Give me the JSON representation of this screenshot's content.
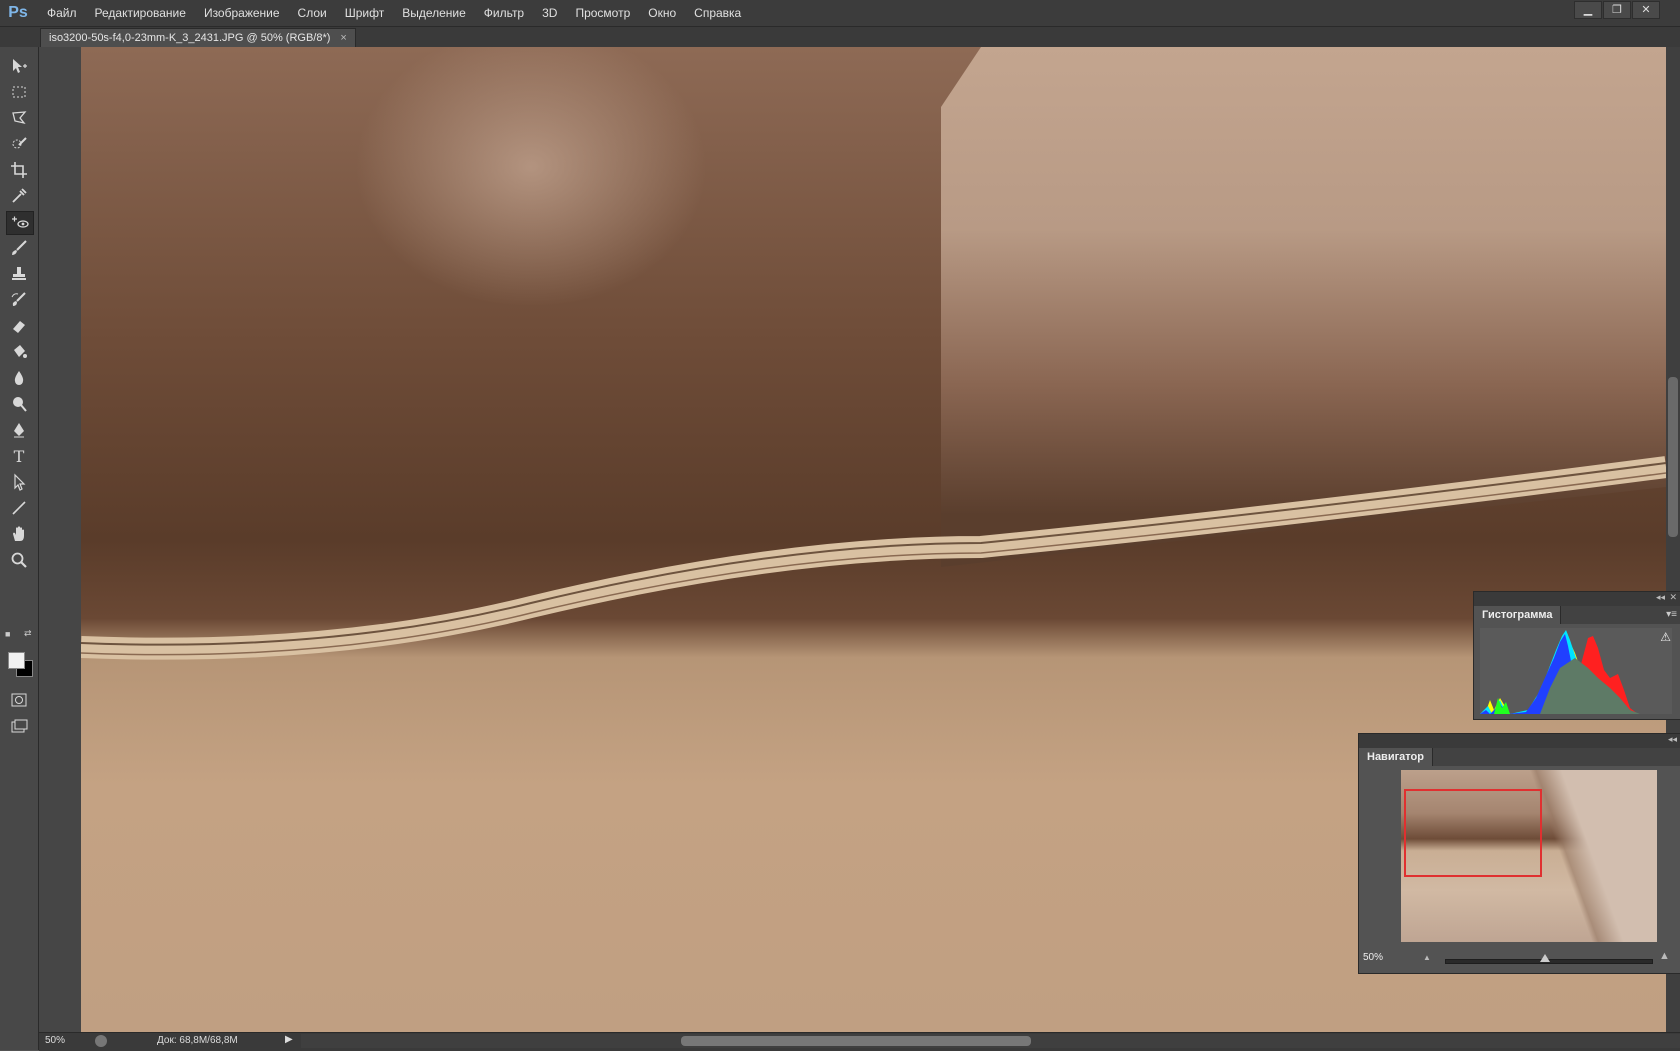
{
  "app": {
    "logo": "Ps"
  },
  "menu": {
    "items": [
      "Файл",
      "Редактирование",
      "Изображение",
      "Слои",
      "Шрифт",
      "Выделение",
      "Фильтр",
      "3D",
      "Просмотр",
      "Окно",
      "Справка"
    ]
  },
  "window_controls": {
    "minimize": "▁",
    "restore": "❐",
    "close": "✕"
  },
  "document": {
    "tab_title": "iso3200-50s-f4,0-23mm-K_3_2431.JPG @ 50% (RGB/8*)",
    "close_icon": "×"
  },
  "toolbar": {
    "collapse": "▸▸",
    "tools": [
      {
        "name": "move-tool",
        "icon": "move-icon"
      },
      {
        "name": "marquee-tool",
        "icon": "marquee-icon"
      },
      {
        "name": "lasso-tool",
        "icon": "lasso-icon"
      },
      {
        "name": "quick-selection-tool",
        "icon": "quick-selection-icon"
      },
      {
        "name": "crop-tool",
        "icon": "crop-icon"
      },
      {
        "name": "eyedropper-tool",
        "icon": "eyedropper-icon"
      },
      {
        "name": "healing-brush-tool",
        "icon": "healing-icon",
        "active": true
      },
      {
        "name": "brush-tool",
        "icon": "brush-icon"
      },
      {
        "name": "clone-stamp-tool",
        "icon": "stamp-icon"
      },
      {
        "name": "history-brush-tool",
        "icon": "history-brush-icon"
      },
      {
        "name": "eraser-tool",
        "icon": "eraser-icon"
      },
      {
        "name": "paint-bucket-tool",
        "icon": "bucket-icon"
      },
      {
        "name": "blur-tool",
        "icon": "blur-icon"
      },
      {
        "name": "dodge-tool",
        "icon": "dodge-icon"
      },
      {
        "name": "pen-tool",
        "icon": "pen-icon"
      },
      {
        "name": "type-tool",
        "icon": "type-icon"
      },
      {
        "name": "path-selection-tool",
        "icon": "arrow-icon"
      },
      {
        "name": "line-tool",
        "icon": "line-icon"
      },
      {
        "name": "hand-tool",
        "icon": "hand-icon"
      },
      {
        "name": "zoom-tool",
        "icon": "zoom-icon"
      }
    ],
    "type_glyph": "T",
    "foreground_color": "#f2f2f2",
    "background_color": "#000000"
  },
  "status": {
    "zoom": "50%",
    "doc_size": "Док: 68,8M/68,8M",
    "arrow": "▶"
  },
  "histogram_panel": {
    "tab": "Гистограмма",
    "menu": "▾≡",
    "warning": "⚠"
  },
  "navigator_panel": {
    "tab": "Навигатор",
    "zoom": "50%",
    "zoom_out": "▲",
    "zoom_in": "▲"
  },
  "panel_controls": {
    "collapse": "◂◂",
    "close": "✕"
  }
}
